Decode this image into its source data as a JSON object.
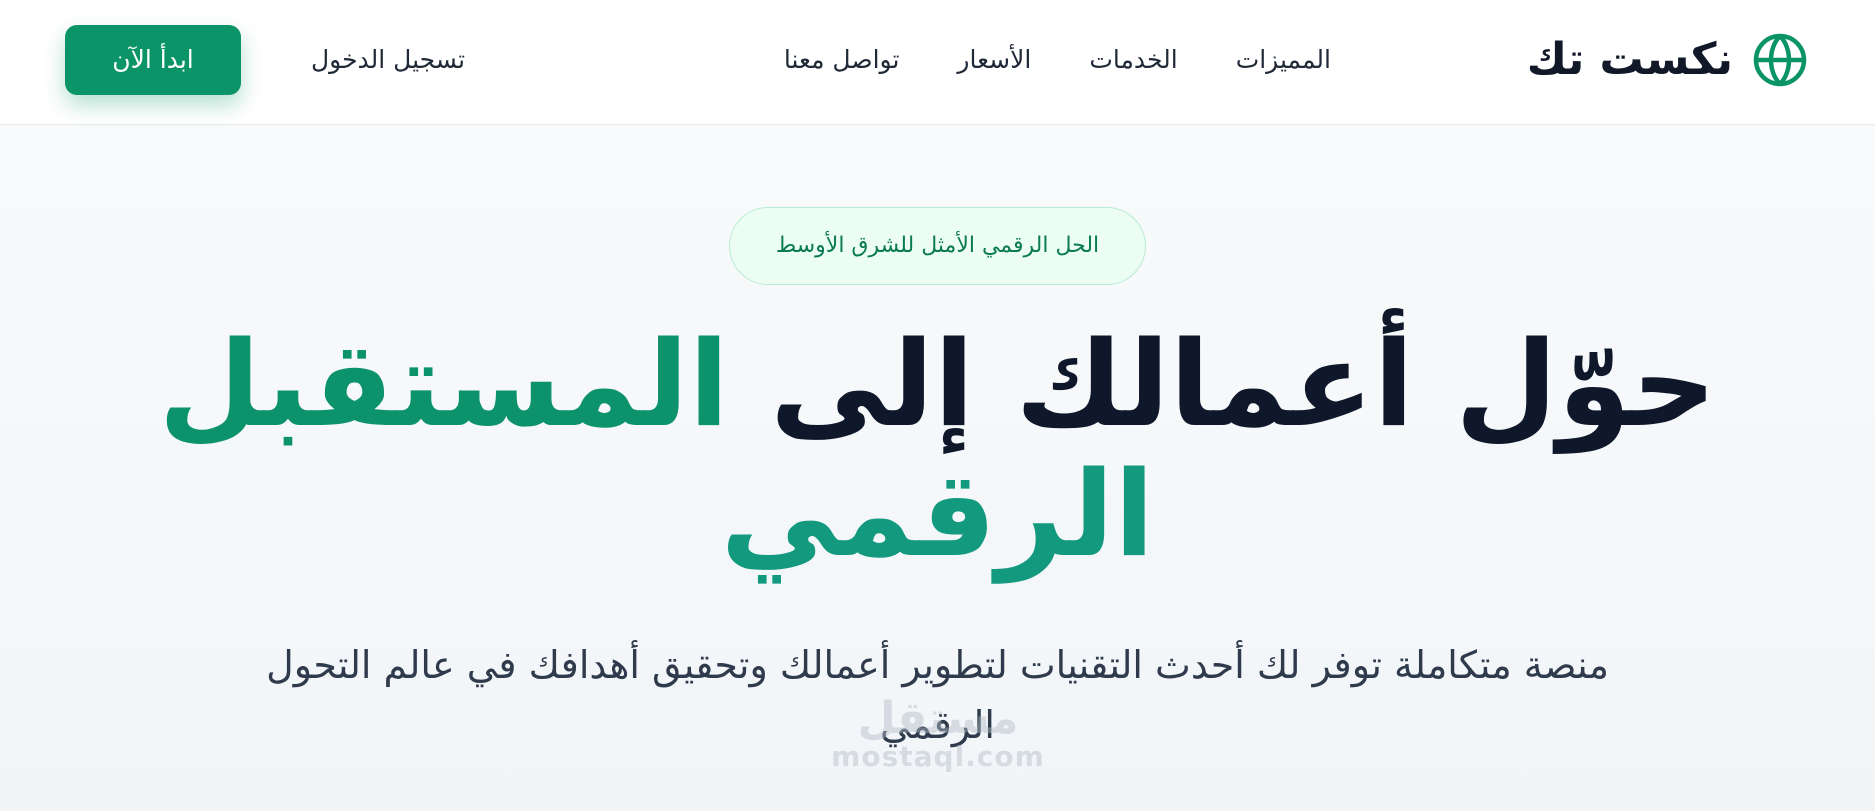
{
  "nav": {
    "brand": "نكست تك",
    "brand_icon": "globe-icon",
    "links": [
      "المميزات",
      "الخدمات",
      "الأسعار",
      "تواصل معنا"
    ],
    "login": "تسجيل الدخول",
    "cta": "ابدأ الآن"
  },
  "hero": {
    "badge": "الحل الرقمي الأمثل للشرق الأوسط",
    "headline_part1": "حوّل أعمالك إلى",
    "headline_part2": "المستقبل",
    "headline_part3": "الرقمي",
    "subtitle": "منصة متكاملة توفر لك أحدث التقنيات لتطوير أعمالك وتحقيق أهدافك في عالم التحول الرقمي"
  },
  "watermark": {
    "text_ar": "مستقل",
    "text_en": "mostaql.com"
  },
  "colors": {
    "accent": "#0b9467",
    "headline_dark": "#0f172a",
    "headline_green": "#0d936b",
    "badge_bg": "#ecfdf4"
  }
}
